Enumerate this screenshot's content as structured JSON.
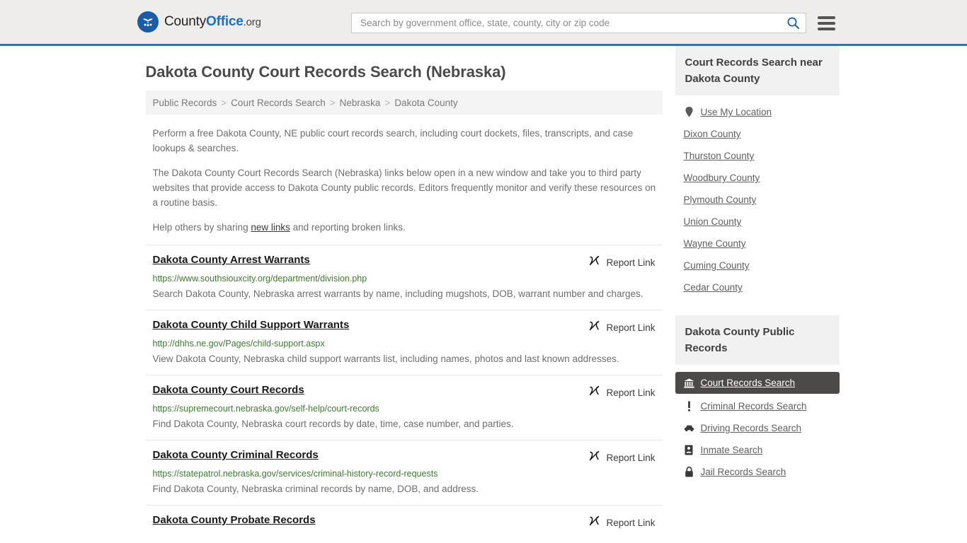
{
  "header": {
    "logo_name_part1": "County",
    "logo_name_part2": "Office",
    "logo_name_part3": ".org",
    "logo_icon": "eagle-shield-icon",
    "search_placeholder": "Search by government office, state, county, city or zip code",
    "search_value": "",
    "search_icon": "search-icon",
    "menu_icon": "hamburger-menu-icon"
  },
  "page": {
    "title": "Dakota County Court Records Search (Nebraska)"
  },
  "breadcrumb": {
    "separator": ">",
    "items": [
      {
        "label": "Public Records"
      },
      {
        "label": "Court Records Search"
      },
      {
        "label": "Nebraska"
      },
      {
        "label": "Dakota County"
      }
    ]
  },
  "intro": {
    "p1": "Perform a free Dakota County, NE public court records search, including court dockets, files, transcripts, and case lookups & searches.",
    "p2": "The Dakota County Court Records Search (Nebraska) links below open in a new window and take you to third party websites that provide access to Dakota County public records. Editors frequently monitor and verify these resources on a routine basis.",
    "p3_before": "Help others by sharing ",
    "p3_link": "new links",
    "p3_after": " and reporting broken links."
  },
  "results": {
    "report_label": "Report Link",
    "report_icon": "broken-link-icon",
    "items": [
      {
        "title": "Dakota County Arrest Warrants",
        "url": "https://www.southsiouxcity.org/department/division.php",
        "description": "Search Dakota County, Nebraska arrest warrants by name, including mugshots, DOB, warrant number and charges."
      },
      {
        "title": "Dakota County Child Support Warrants",
        "url": "http://dhhs.ne.gov/Pages/child-support.aspx",
        "description": "View Dakota County, Nebraska child support warrants list, including names, photos and last known addresses."
      },
      {
        "title": "Dakota County Court Records",
        "url": "https://supremecourt.nebraska.gov/self-help/court-records",
        "description": "Find Dakota County, Nebraska court records by date, time, case number, and parties."
      },
      {
        "title": "Dakota County Criminal Records",
        "url": "https://statepatrol.nebraska.gov/services/criminal-history-record-requests",
        "description": "Find Dakota County, Nebraska criminal records by name, DOB, and address."
      },
      {
        "title": "Dakota County Probate Records",
        "url": "",
        "description": ""
      }
    ]
  },
  "sidebar": {
    "nearby": {
      "heading": "Court Records Search near Dakota County",
      "use_my_location": {
        "label": "Use My Location",
        "icon": "map-pin-icon"
      },
      "counties": [
        {
          "label": "Dixon County"
        },
        {
          "label": "Thurston County"
        },
        {
          "label": "Woodbury County"
        },
        {
          "label": "Plymouth County"
        },
        {
          "label": "Union County"
        },
        {
          "label": "Wayne County"
        },
        {
          "label": "Cuming County"
        },
        {
          "label": "Cedar County"
        }
      ]
    },
    "public_records": {
      "heading": "Dakota County Public Records",
      "items": [
        {
          "label": "Court Records Search",
          "icon": "courthouse-icon",
          "active": true
        },
        {
          "label": "Criminal Records Search",
          "icon": "exclamation-icon",
          "active": false
        },
        {
          "label": "Driving Records Search",
          "icon": "car-icon",
          "active": false
        },
        {
          "label": "Inmate Search",
          "icon": "id-card-icon",
          "active": false
        },
        {
          "label": "Jail Records Search",
          "icon": "lock-icon",
          "active": false
        }
      ]
    }
  },
  "colors": {
    "header_bg": "#eeedeb",
    "header_border": "#3b72a6",
    "logo_blue": "#1a6fc4",
    "url_green": "#3f7a33",
    "body_text": "#6e6e6e",
    "active_bg": "#4b4a48"
  }
}
